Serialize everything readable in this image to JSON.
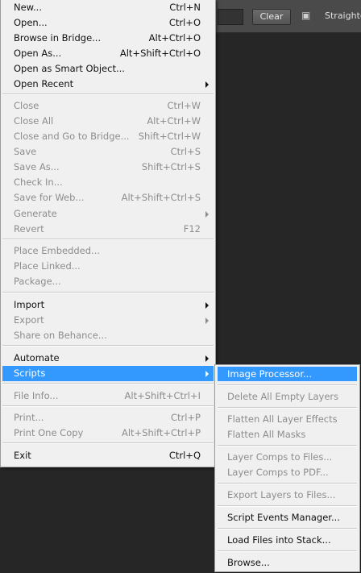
{
  "options_bar": {
    "clear_label": "Clear",
    "straighten_label": "Straighten",
    "straighten_icon": "straighten-icon"
  },
  "file_menu": {
    "items": [
      {
        "label": "New...",
        "shortcut": "Ctrl+N",
        "enabled": true
      },
      {
        "label": "Open...",
        "shortcut": "Ctrl+O",
        "enabled": true
      },
      {
        "label": "Browse in Bridge...",
        "shortcut": "Alt+Ctrl+O",
        "enabled": true
      },
      {
        "label": "Open As...",
        "shortcut": "Alt+Shift+Ctrl+O",
        "enabled": true
      },
      {
        "label": "Open as Smart Object...",
        "shortcut": "",
        "enabled": true
      },
      {
        "label": "Open Recent",
        "shortcut": "",
        "enabled": true,
        "submenu": true
      },
      {
        "label": "Close",
        "shortcut": "Ctrl+W",
        "enabled": false
      },
      {
        "label": "Close All",
        "shortcut": "Alt+Ctrl+W",
        "enabled": false
      },
      {
        "label": "Close and Go to Bridge...",
        "shortcut": "Shift+Ctrl+W",
        "enabled": false
      },
      {
        "label": "Save",
        "shortcut": "Ctrl+S",
        "enabled": false
      },
      {
        "label": "Save As...",
        "shortcut": "Shift+Ctrl+S",
        "enabled": false
      },
      {
        "label": "Check In...",
        "shortcut": "",
        "enabled": false
      },
      {
        "label": "Save for Web...",
        "shortcut": "Alt+Shift+Ctrl+S",
        "enabled": false
      },
      {
        "label": "Generate",
        "shortcut": "",
        "enabled": false,
        "submenu": true
      },
      {
        "label": "Revert",
        "shortcut": "F12",
        "enabled": false
      },
      {
        "label": "Place Embedded...",
        "shortcut": "",
        "enabled": false
      },
      {
        "label": "Place Linked...",
        "shortcut": "",
        "enabled": false
      },
      {
        "label": "Package...",
        "shortcut": "",
        "enabled": false
      },
      {
        "label": "Import",
        "shortcut": "",
        "enabled": true,
        "submenu": true
      },
      {
        "label": "Export",
        "shortcut": "",
        "enabled": false,
        "submenu": true
      },
      {
        "label": "Share on Behance...",
        "shortcut": "",
        "enabled": false
      },
      {
        "label": "Automate",
        "shortcut": "",
        "enabled": true,
        "submenu": true
      },
      {
        "label": "Scripts",
        "shortcut": "",
        "enabled": true,
        "submenu": true,
        "highlighted": true
      },
      {
        "label": "File Info...",
        "shortcut": "Alt+Shift+Ctrl+I",
        "enabled": false
      },
      {
        "label": "Print...",
        "shortcut": "Ctrl+P",
        "enabled": false
      },
      {
        "label": "Print One Copy",
        "shortcut": "Alt+Shift+Ctrl+P",
        "enabled": false
      },
      {
        "label": "Exit",
        "shortcut": "Ctrl+Q",
        "enabled": true
      }
    ]
  },
  "scripts_menu": {
    "items": [
      {
        "label": "Image Processor...",
        "enabled": true,
        "highlighted": true
      },
      {
        "label": "Delete All Empty Layers",
        "enabled": false
      },
      {
        "label": "Flatten All Layer Effects",
        "enabled": false
      },
      {
        "label": "Flatten All Masks",
        "enabled": false
      },
      {
        "label": "Layer Comps to Files...",
        "enabled": false
      },
      {
        "label": "Layer Comps to PDF...",
        "enabled": false
      },
      {
        "label": "Export Layers to Files...",
        "enabled": false
      },
      {
        "label": "Script Events Manager...",
        "enabled": true
      },
      {
        "label": "Load Files into Stack...",
        "enabled": true
      },
      {
        "label": "Browse...",
        "enabled": true
      }
    ]
  }
}
